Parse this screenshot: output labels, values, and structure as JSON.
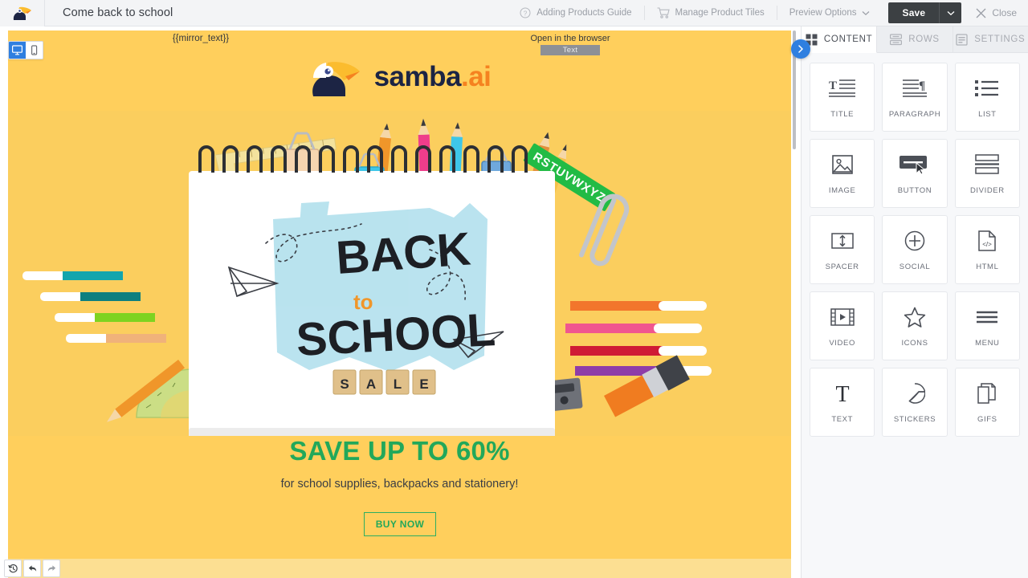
{
  "topbar": {
    "logo_icon": "toucan-logo-icon",
    "title": "Come back to school",
    "help_item": {
      "icon": "question-circle-icon",
      "label": "Adding Products Guide"
    },
    "products_item": {
      "icon": "shopping-cart-icon",
      "label": "Manage Product Tiles"
    },
    "preview_item": {
      "label": "Preview Options",
      "caret_icon": "chevron-down-icon"
    },
    "save_label": "Save",
    "save_caret_icon": "chevron-down-icon",
    "close": {
      "icon": "close-x-icon",
      "label": "Close"
    }
  },
  "canvas": {
    "view_toggle": {
      "desktop": {
        "icon": "desktop-monitor-icon",
        "active": true
      },
      "mobile": {
        "icon": "mobile-phone-icon",
        "active": false
      }
    },
    "mirror_text": "{{mirror_text}}",
    "open_in_browser": "Open in the browser",
    "text_badge": "Text",
    "brand": {
      "name": "samba",
      "suffix": ".ai",
      "logo_icon": "toucan-logo-icon"
    },
    "hero": {
      "notebook_lines": [
        "BACK",
        "to",
        "SCHOOL"
      ],
      "sale_tiles": [
        "S",
        "A",
        "L",
        "E"
      ],
      "ruler_letters": "RSTUVWXYZ"
    },
    "promo_heading": "SAVE UP TO 60%",
    "promo_sub": "for school supplies, backpacks and stationery!",
    "buy_button": "BUY NOW",
    "history": [
      {
        "icon": "history-clock-icon",
        "name": "history"
      },
      {
        "icon": "undo-arrow-icon",
        "name": "undo"
      },
      {
        "icon": "redo-arrow-icon",
        "name": "redo"
      }
    ]
  },
  "panel": {
    "toggle_icon": "chevron-right-icon",
    "tabs": [
      {
        "label": "CONTENT",
        "icon": "grid-icon",
        "active": true
      },
      {
        "label": "ROWS",
        "icon": "rows-icon",
        "active": false
      },
      {
        "label": "SETTINGS",
        "icon": "settings-panel-icon",
        "active": false
      }
    ],
    "blocks": [
      {
        "label": "TITLE",
        "icon": "title-icon"
      },
      {
        "label": "PARAGRAPH",
        "icon": "paragraph-icon"
      },
      {
        "label": "LIST",
        "icon": "list-icon"
      },
      {
        "label": "IMAGE",
        "icon": "image-icon"
      },
      {
        "label": "BUTTON",
        "icon": "button-icon"
      },
      {
        "label": "DIVIDER",
        "icon": "divider-icon"
      },
      {
        "label": "SPACER",
        "icon": "spacer-icon"
      },
      {
        "label": "SOCIAL",
        "icon": "social-plus-icon"
      },
      {
        "label": "HTML",
        "icon": "html-code-icon"
      },
      {
        "label": "VIDEO",
        "icon": "video-film-icon"
      },
      {
        "label": "ICONS",
        "icon": "star-icon"
      },
      {
        "label": "MENU",
        "icon": "menu-hamburger-icon"
      },
      {
        "label": "TEXT",
        "icon": "text-t-icon"
      },
      {
        "label": "STICKERS",
        "icon": "sticker-icon"
      },
      {
        "label": "GIFS",
        "icon": "gif-pages-icon"
      }
    ]
  },
  "colors": {
    "canvas_bg": "#FFCF5C",
    "canvas_band": "#FCDF92",
    "brand_navy": "#1c2444",
    "brand_orange": "#f58220",
    "promo_green": "#22A85A",
    "accent_blue": "#2f7fe0",
    "save_dark": "#3c4043"
  }
}
